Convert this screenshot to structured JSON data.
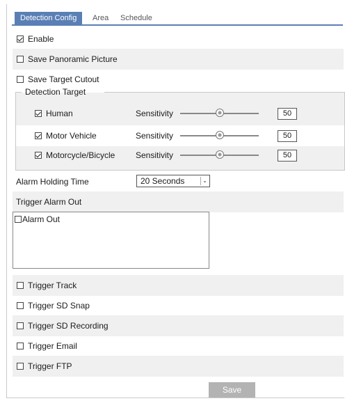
{
  "tabs": [
    {
      "label": "Detection Config",
      "active": true
    },
    {
      "label": "Area",
      "active": false
    },
    {
      "label": "Schedule",
      "active": false
    }
  ],
  "enable": {
    "label": "Enable",
    "checked": true
  },
  "save_panoramic": {
    "label": "Save Panoramic Picture",
    "checked": false
  },
  "save_cutout": {
    "label": "Save Target Cutout",
    "checked": false
  },
  "detection_target": {
    "legend": "Detection Target",
    "sensitivity_label": "Sensitivity",
    "targets": [
      {
        "label": "Human",
        "checked": true,
        "sensitivity": 50
      },
      {
        "label": "Motor Vehicle",
        "checked": true,
        "sensitivity": 50
      },
      {
        "label": "Motorcycle/Bicycle",
        "checked": true,
        "sensitivity": 50
      }
    ]
  },
  "alarm_holding": {
    "label": "Alarm Holding Time",
    "value": "20 Seconds"
  },
  "trigger_alarm_out": {
    "label": "Trigger Alarm Out",
    "items": [
      {
        "label": "Alarm Out",
        "checked": false
      }
    ]
  },
  "triggers": [
    {
      "label": "Trigger Track",
      "checked": false
    },
    {
      "label": "Trigger SD Snap",
      "checked": false
    },
    {
      "label": "Trigger SD Recording",
      "checked": false
    },
    {
      "label": "Trigger Email",
      "checked": false
    },
    {
      "label": "Trigger FTP",
      "checked": false
    }
  ],
  "save_label": "Save",
  "colors": {
    "accent": "#5a7fb5",
    "row_shade": "#f0f0f0",
    "save_button": "#b3b3b3"
  }
}
